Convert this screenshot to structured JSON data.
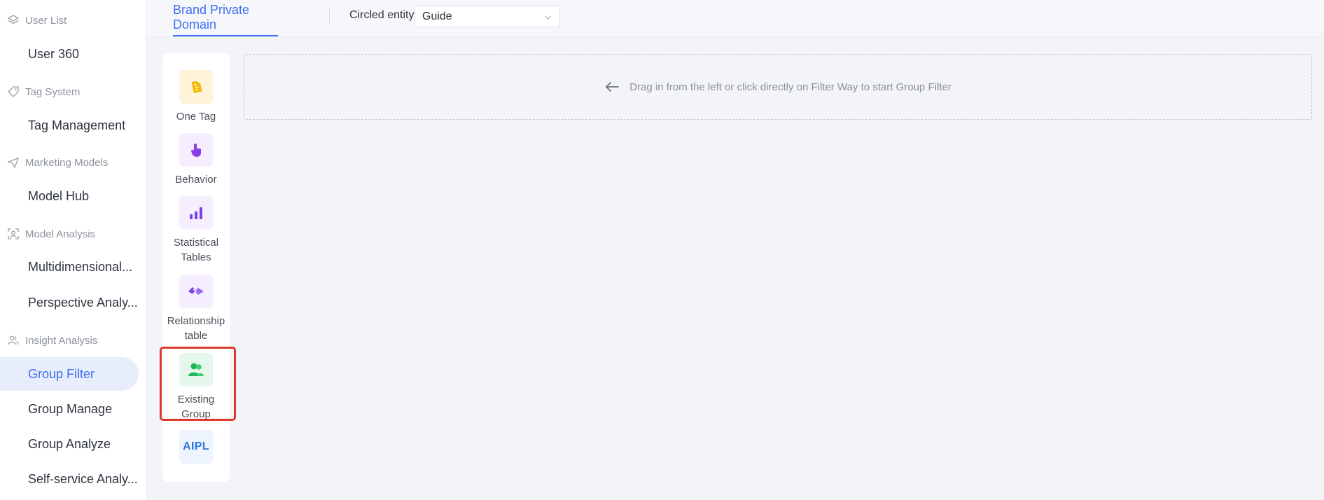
{
  "sidebar": {
    "groups": [
      {
        "label": "User List",
        "icon": "layers-icon",
        "items": [
          "User 360"
        ]
      },
      {
        "label": "Tag System",
        "icon": "tag-icon",
        "items": [
          "Tag Management"
        ]
      },
      {
        "label": "Marketing Models",
        "icon": "send-icon",
        "items": [
          "Model Hub"
        ]
      },
      {
        "label": "Model Analysis",
        "icon": "person-scan-icon",
        "items": [
          "Multidimensional...",
          "Perspective Analy..."
        ]
      },
      {
        "label": "Insight Analysis",
        "icon": "users-icon",
        "items": [
          "Group Filter",
          "Group Manage",
          "Group Analyze",
          "Self-service Analy..."
        ]
      }
    ],
    "active_item": "Group Filter"
  },
  "topbar": {
    "tab": "Brand Private Domain",
    "entity_label": "Circled entity:",
    "entity_value": "Guide"
  },
  "palette": {
    "items": [
      {
        "label": "One Tag",
        "icon": "tag-icon"
      },
      {
        "label": "Behavior",
        "icon": "pointer-hand-icon"
      },
      {
        "label": "Statistical Tables",
        "icon": "bar-chart-icon"
      },
      {
        "label": "Relationship table",
        "icon": "link-icon"
      },
      {
        "label": "Existing Group",
        "icon": "group-icon",
        "highlighted": true
      },
      {
        "label": "AIPL",
        "icon": "aipl-icon"
      }
    ]
  },
  "dropzone": {
    "hint": "Drag in from the left or click directly on Filter Way to start Group Filter"
  },
  "colors": {
    "accent": "#3d6ff2",
    "highlight": "#d93a2b"
  }
}
